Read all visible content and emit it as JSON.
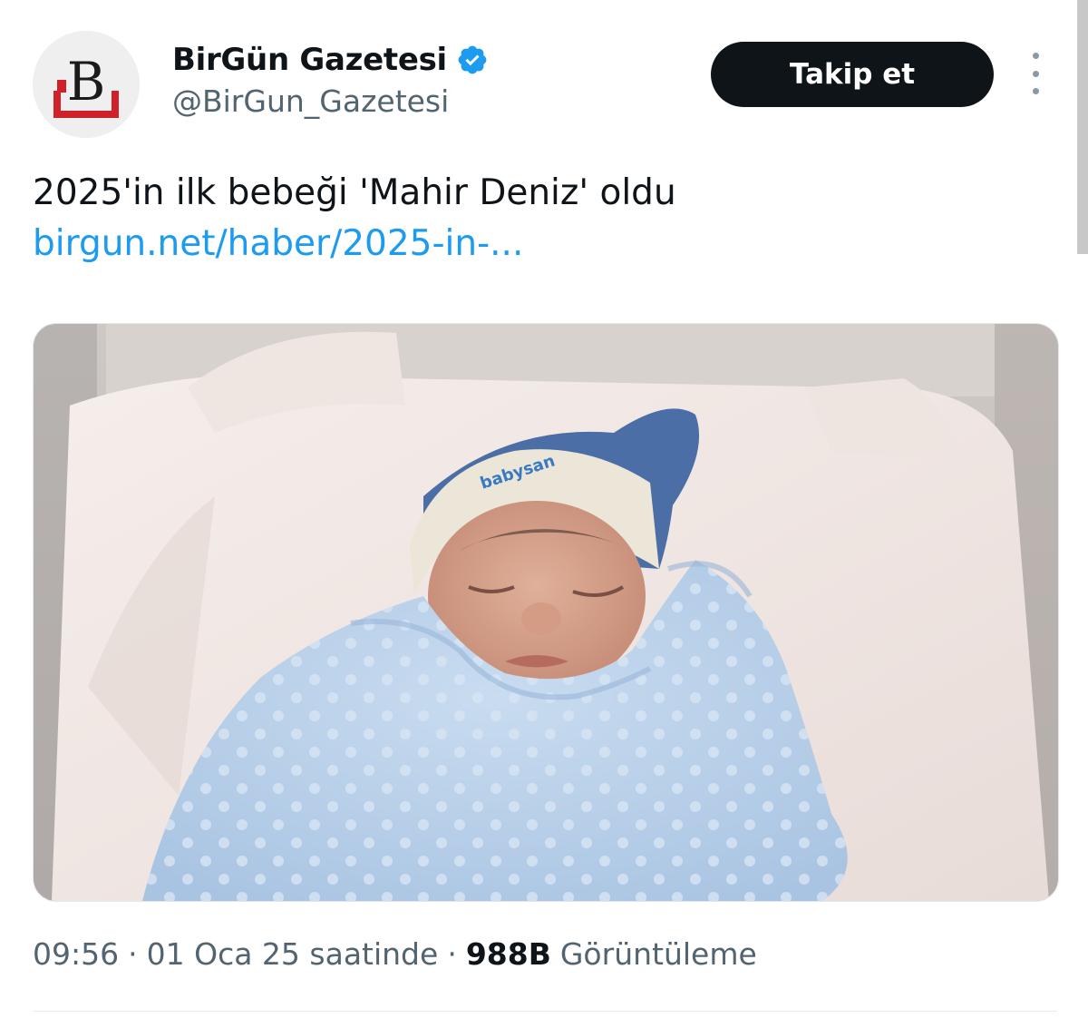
{
  "account": {
    "display_name": "BirGün Gazetesi",
    "handle": "@BirGun_Gazetesi",
    "avatar_letter": "B",
    "verified_icon": "verified-badge-icon",
    "brand_color": "#d0202a"
  },
  "follow_button": {
    "label": "Takip et"
  },
  "tweet": {
    "text": "2025'in ilk bebeği 'Mahir Deniz' oldu",
    "link_text": "birgun.net/haber/2025-in-...",
    "media_hat_text": "babysan"
  },
  "meta": {
    "time": "09:56",
    "date": "01 Oca 25 saatinde",
    "views_count": "988B",
    "views_label": "Görüntüleme",
    "separator": "·"
  },
  "colors": {
    "link": "#1d9bf0",
    "button_bg": "#0f1419",
    "secondary_text": "#536471",
    "verified": "#1d9bf0"
  }
}
